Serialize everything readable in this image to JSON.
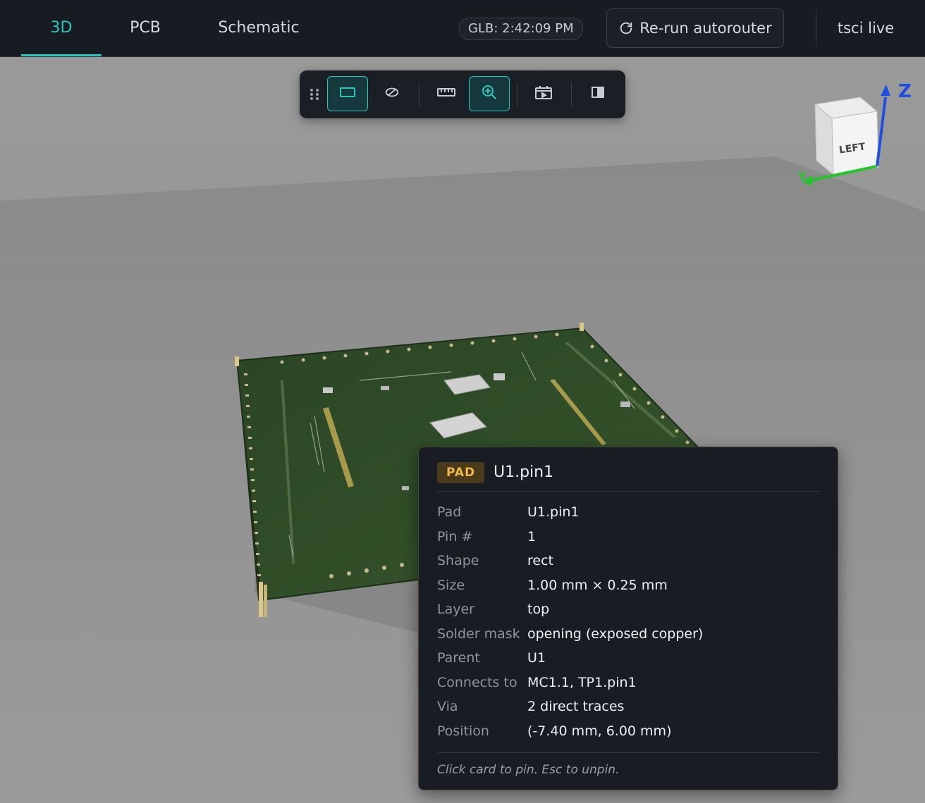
{
  "tabs": [
    {
      "label": "3D",
      "active": true
    },
    {
      "label": "PCB",
      "active": false
    },
    {
      "label": "Schematic",
      "active": false
    }
  ],
  "header": {
    "glb_status": "GLB: 2:42:09 PM",
    "rerun_label": "Re-run autorouter",
    "live_label": "tsci live"
  },
  "toolbar": {
    "tools": [
      {
        "icon": "drag-handle-icon",
        "active": false
      },
      {
        "icon": "rectangle-view-icon",
        "active": true
      },
      {
        "icon": "hide-layer-icon",
        "active": false
      },
      {
        "icon": "ruler-icon",
        "active": false
      },
      {
        "icon": "zoom-icon",
        "active": true
      },
      {
        "icon": "animation-icon",
        "active": false
      },
      {
        "icon": "split-view-icon",
        "active": false
      }
    ]
  },
  "gizmo": {
    "face_label": "LEFT",
    "axis_z_label": "Z",
    "axis_y_label": "Y",
    "axis_colors": {
      "z": "#1f4fe0",
      "y": "#22c52a"
    }
  },
  "pad_card": {
    "badge": "PAD",
    "title": "U1.pin1",
    "rows": [
      {
        "key": "Pad",
        "value": "U1.pin1"
      },
      {
        "key": "Pin #",
        "value": "1"
      },
      {
        "key": "Shape",
        "value": "rect"
      },
      {
        "key": "Size",
        "value": "1.00 mm × 0.25 mm"
      },
      {
        "key": "Layer",
        "value": "top"
      },
      {
        "key": "Solder mask",
        "value": "opening (exposed copper)"
      },
      {
        "key": "Parent",
        "value": "U1"
      },
      {
        "key": "Connects to",
        "value": "MC1.1, TP1.pin1"
      },
      {
        "key": "Via",
        "value": "2 direct traces"
      },
      {
        "key": "Position",
        "value": "(-7.40 mm, 6.00 mm)"
      }
    ],
    "hint": "Click card to pin. Esc to unpin."
  },
  "colors": {
    "accent": "#2cc6bf",
    "topbar_bg": "#171b22",
    "card_bg": "#191c22",
    "badge_text": "#f0b646",
    "pcb_green": "#2f4a27"
  }
}
